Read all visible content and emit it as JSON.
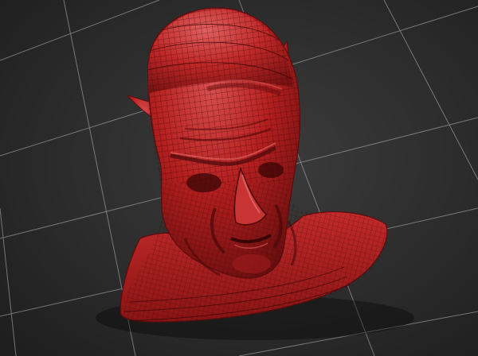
{
  "viewport": {
    "name": "3d-sculpt-viewport",
    "background_top": "#3c3c3c",
    "background_mid": "#2a2a2a",
    "background_bottom": "#1a1a1a",
    "grid_color": "#b8b8b8"
  },
  "model": {
    "name": "sculpted-bust",
    "base_color": "#b51f1f",
    "shadow_color": "#5e0c0c",
    "highlight_color": "#d95050",
    "wireframe_color": "#3c0707",
    "show_wireframe": true
  }
}
